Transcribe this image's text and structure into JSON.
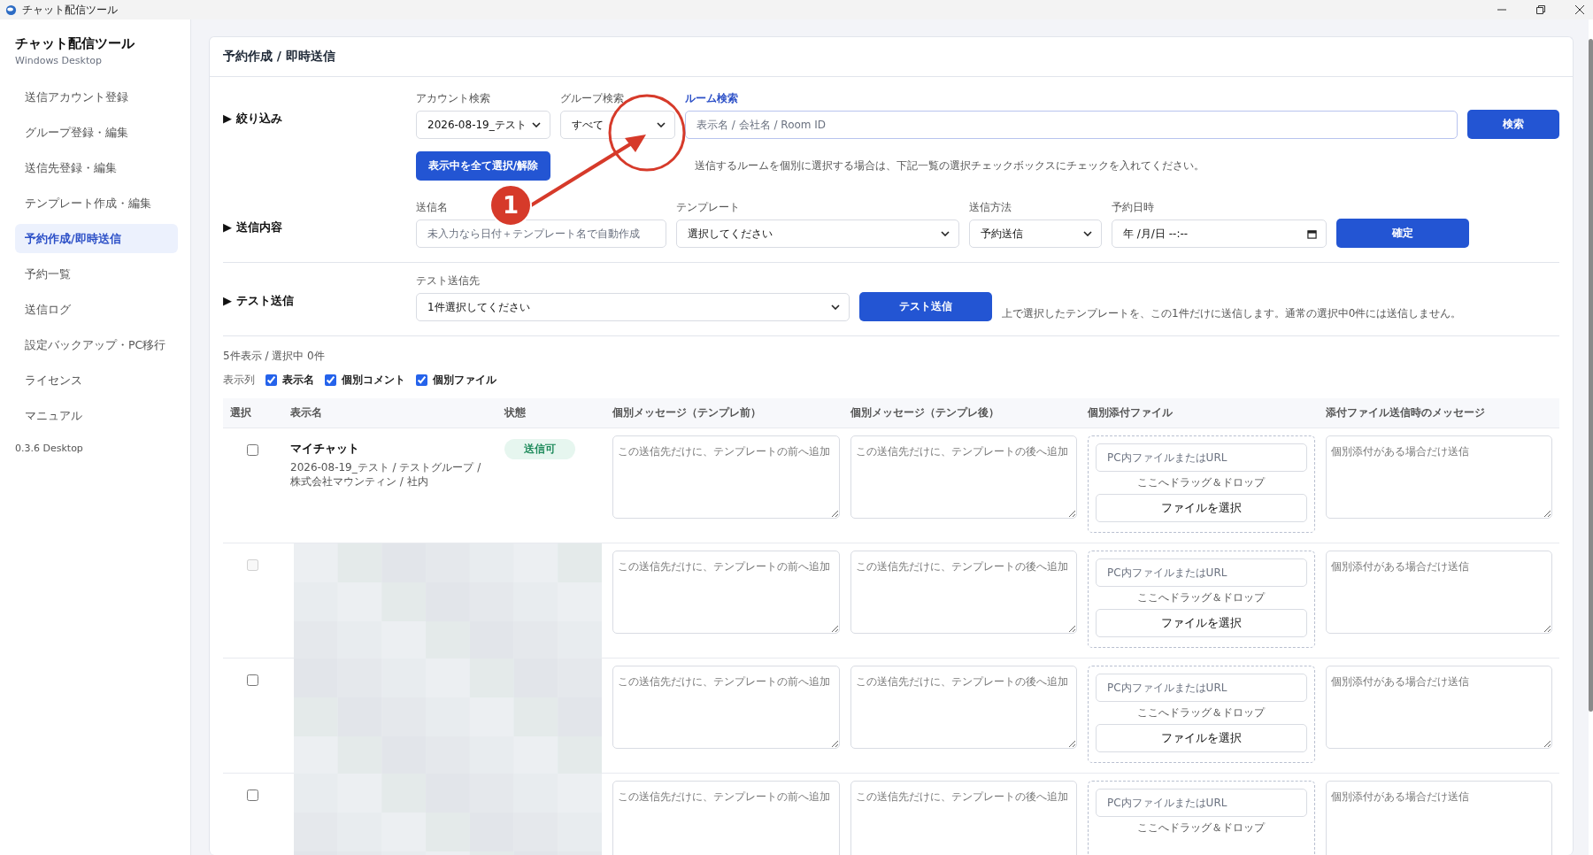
{
  "window": {
    "title": "チャット配信ツール"
  },
  "sidebar": {
    "title": "チャット配信ツール",
    "subtitle": "Windows Desktop",
    "items": [
      {
        "label": "送信アカウント登録",
        "selected": false
      },
      {
        "label": "グループ登録・編集",
        "selected": false
      },
      {
        "label": "送信先登録・編集",
        "selected": false
      },
      {
        "label": "テンプレート作成・編集",
        "selected": false
      },
      {
        "label": "予約作成/即時送信",
        "selected": true
      },
      {
        "label": "予約一覧",
        "selected": false
      },
      {
        "label": "送信ログ",
        "selected": false
      },
      {
        "label": "設定バックアップ・PC移行",
        "selected": false
      },
      {
        "label": "ライセンス",
        "selected": false
      },
      {
        "label": "マニュアル",
        "selected": false
      }
    ],
    "version": "0.3.6 Desktop"
  },
  "page": {
    "title": "予約作成 / 即時送信"
  },
  "filter": {
    "label": "▶ 絞り込み",
    "account": {
      "label": "アカウント検索",
      "value": "2026-08-19_テスト"
    },
    "group": {
      "label": "グループ検索",
      "value": "すべて"
    },
    "room": {
      "label": "ルーム検索",
      "placeholder": "表示名 / 会社名 / Room ID"
    },
    "search_button": "検索",
    "toggle_button": "表示中を全て選択/解除",
    "hint": "送信するルームを個別に選択する場合は、下記一覧の選択チェックボックスにチェックを入れてください。"
  },
  "content": {
    "label": "▶ 送信内容",
    "name": {
      "label": "送信名",
      "placeholder": "未入力なら日付＋テンプレート名で自動作成"
    },
    "template": {
      "label": "テンプレート",
      "value": "選択してください"
    },
    "method": {
      "label": "送信方法",
      "value": "予約送信"
    },
    "datetime": {
      "label": "予約日時",
      "value": "年 /月/日  --:--"
    },
    "confirm_button": "確定"
  },
  "test": {
    "label": "▶ テスト送信",
    "target": {
      "label": "テスト送信先",
      "value": "1件選択してください"
    },
    "button": "テスト送信",
    "note": "上で選択したテンプレートを、この1件だけに送信します。通常の選択中0件には送信しません。"
  },
  "summary": "5件表示 / 選択中 0件",
  "columns_toggle": {
    "label": "表示列",
    "options": [
      {
        "label": "表示名",
        "checked": true
      },
      {
        "label": "個別コメント",
        "checked": true
      },
      {
        "label": "個別ファイル",
        "checked": true
      }
    ]
  },
  "table": {
    "columns": [
      "選択",
      "表示名",
      "状態",
      "個別メッセージ（テンプレ前）",
      "個別メッセージ（テンプレ後）",
      "個別添付ファイル",
      "添付ファイル送信時のメッセージ"
    ],
    "rows": [
      {
        "checked": false,
        "disabled": false,
        "name": "マイチャット",
        "detail": "2026-08-19_テスト / テストグループ / 株式会社マウンティン / 社内",
        "status": {
          "label": "送信可",
          "kind": "ok"
        },
        "before_placeholder": "この送信先だけに、テンプレートの前へ追加",
        "after_placeholder": "この送信先だけに、テンプレートの後へ追加",
        "file_placeholder": "PC内ファイルまたはURL",
        "drop": "ここへドラッグ＆ドロップ",
        "file_button": "ファイルを選択",
        "attach_placeholder": "個別添付がある場合だけ送信"
      },
      {
        "checked": false,
        "disabled": true,
        "redacted": true,
        "before_placeholder": "この送信先だけに、テンプレートの前へ追加",
        "after_placeholder": "この送信先だけに、テンプレートの後へ追加",
        "file_placeholder": "PC内ファイルまたはURL",
        "drop": "ここへドラッグ＆ドロップ",
        "file_button": "ファイルを選択",
        "attach_placeholder": "個別添付がある場合だけ送信"
      },
      {
        "checked": false,
        "disabled": false,
        "redacted": true,
        "before_placeholder": "この送信先だけに、テンプレートの前へ追加",
        "after_placeholder": "この送信先だけに、テンプレートの後へ追加",
        "file_placeholder": "PC内ファイルまたはURL",
        "drop": "ここへドラッグ＆ドロップ",
        "file_button": "ファイルを選択",
        "attach_placeholder": "個別添付がある場合だけ送信"
      },
      {
        "checked": false,
        "disabled": false,
        "redacted": true,
        "before_placeholder": "この送信先だけに、テンプレートの前へ追加",
        "after_placeholder": "この送信先だけに、テンプレートの後へ追加",
        "file_placeholder": "PC内ファイルまたはURL",
        "drop": "ここへドラッグ＆ドロップ",
        "attach_placeholder": "個別添付がある場合だけ送信"
      }
    ]
  },
  "annotation": {
    "number": "1"
  }
}
